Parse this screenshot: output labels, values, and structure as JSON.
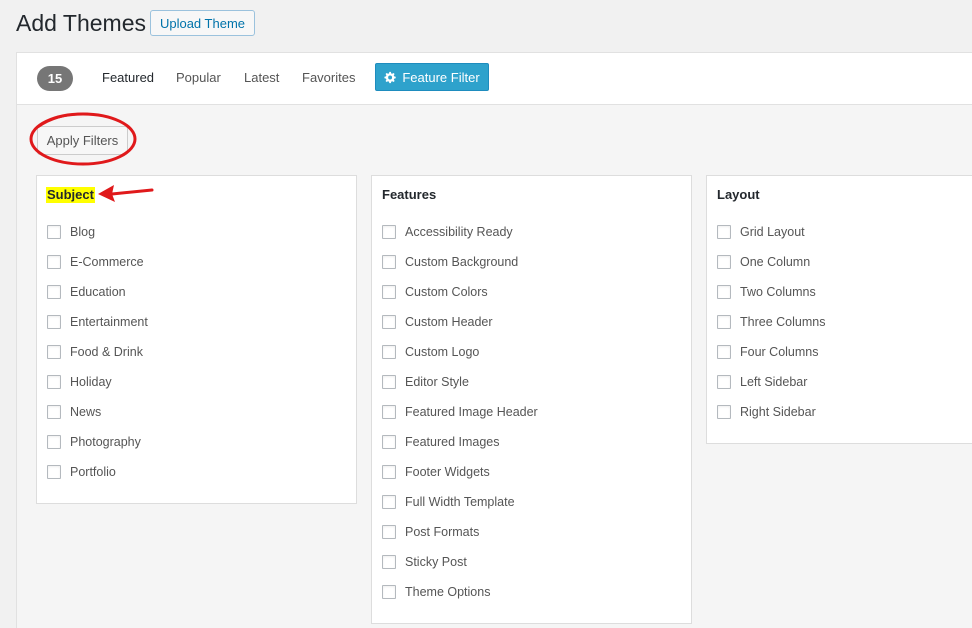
{
  "header": {
    "title": "Add Themes",
    "upload_label": "Upload Theme"
  },
  "filter_bar": {
    "count": "15",
    "tabs": [
      {
        "label": "Featured",
        "current": true
      },
      {
        "label": "Popular",
        "current": false
      },
      {
        "label": "Latest",
        "current": false
      },
      {
        "label": "Favorites",
        "current": false
      }
    ],
    "feature_filter_label": "Feature Filter",
    "feature_filter_icon": "gear-icon",
    "accent_color": "#2ea2cc"
  },
  "apply_filters_label": "Apply Filters",
  "annotation_color": "#e0191b",
  "highlight_color": "#ffff00",
  "groups": {
    "subject": {
      "title": "Subject",
      "options": [
        "Blog",
        "E-Commerce",
        "Education",
        "Entertainment",
        "Food & Drink",
        "Holiday",
        "News",
        "Photography",
        "Portfolio"
      ]
    },
    "features": {
      "title": "Features",
      "options": [
        "Accessibility Ready",
        "Custom Background",
        "Custom Colors",
        "Custom Header",
        "Custom Logo",
        "Editor Style",
        "Featured Image Header",
        "Featured Images",
        "Footer Widgets",
        "Full Width Template",
        "Post Formats",
        "Sticky Post",
        "Theme Options"
      ]
    },
    "layout": {
      "title": "Layout",
      "options": [
        "Grid Layout",
        "One Column",
        "Two Columns",
        "Three Columns",
        "Four Columns",
        "Left Sidebar",
        "Right Sidebar"
      ]
    }
  }
}
